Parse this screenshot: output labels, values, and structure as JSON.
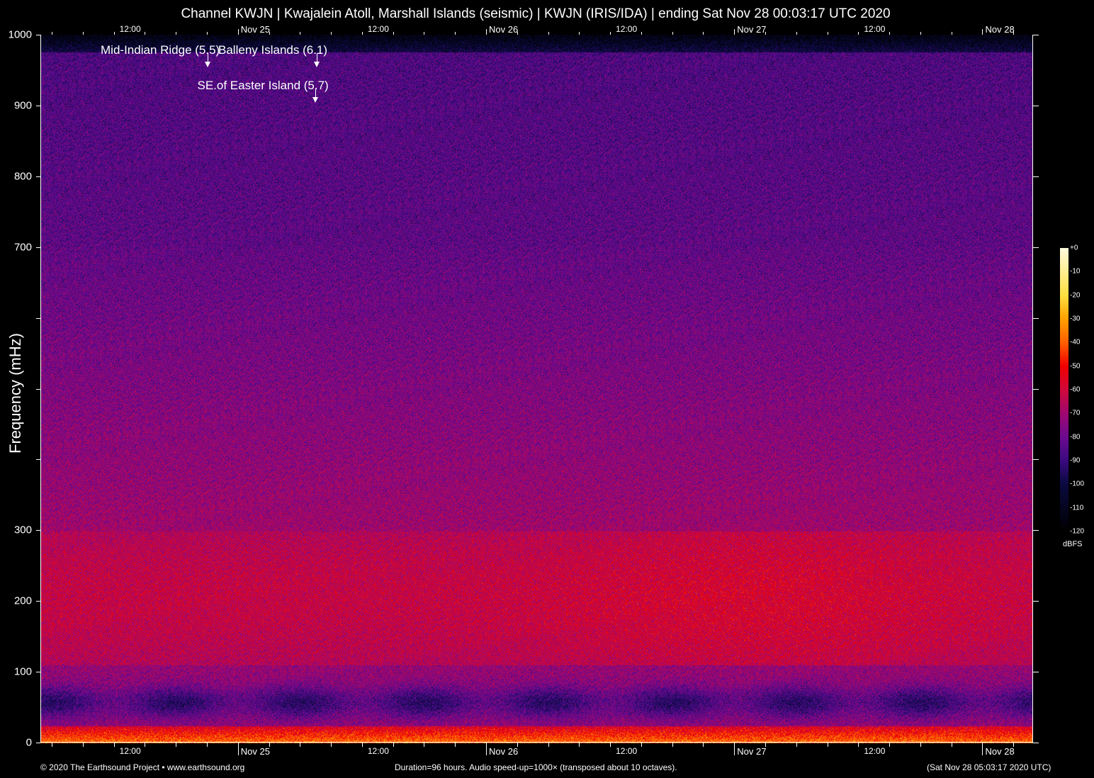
{
  "chart_data": {
    "type": "heatmap",
    "title": "Channel KWJN | Kwajalein Atoll, Marshall Islands (seismic) | KWJN (IRIS/IDA) | ending Sat Nov 28 00:03:17 UTC 2020",
    "ylabel": "Frequency (mHz)",
    "xlabel": "",
    "ylim": [
      0,
      1000
    ],
    "yticks": [
      0,
      100,
      200,
      300,
      400,
      500,
      600,
      700,
      800,
      900,
      1000
    ],
    "ytick_labels": [
      "0",
      "100",
      "200",
      "300",
      "",
      "",
      "",
      "700",
      "800",
      "900",
      "1000"
    ],
    "xlim_hours_rel_nov25": [
      -19.1,
      76.9
    ],
    "xticks": [
      {
        "hour": -12,
        "label": "12:00"
      },
      {
        "hour": 0,
        "label": "Nov 25"
      },
      {
        "hour": 12,
        "label": "12:00"
      },
      {
        "hour": 24,
        "label": "Nov 26"
      },
      {
        "hour": 36,
        "label": "12:00"
      },
      {
        "hour": 48,
        "label": "Nov 27"
      },
      {
        "hour": 60,
        "label": "12:00"
      },
      {
        "hour": 72,
        "label": "Nov 28"
      }
    ],
    "colorbar": {
      "unit": "dBFS",
      "range": [
        -120,
        0
      ],
      "ticks": [
        "+0",
        "-10",
        "-20",
        "-30",
        "-40",
        "-50",
        "-60",
        "-70",
        "-80",
        "-90",
        "-100",
        "-110",
        "-120"
      ]
    },
    "annotations": [
      {
        "label": "Mid-Indian Ridge (5.5)",
        "hour": -2.9,
        "freq": 960
      },
      {
        "label": "Balleny Islands (6.1)",
        "hour": 7.6,
        "freq": 960
      },
      {
        "label": "SE.of Easter Island (5.7)",
        "hour": 7.5,
        "freq": 910
      }
    ],
    "colors": {
      "low": "#000000",
      "mid": "#6a0a90",
      "high": "#f00000",
      "peak": "#fffbe0"
    }
  },
  "footer": {
    "copyright": "© 2020 The Earthsound Project • www.earthsound.org",
    "info": "Duration=96 hours. Audio speed-up=1000× (transposed about 10 octaves).",
    "time": "(Sat Nov 28 05:03:17 2020 UTC)"
  }
}
